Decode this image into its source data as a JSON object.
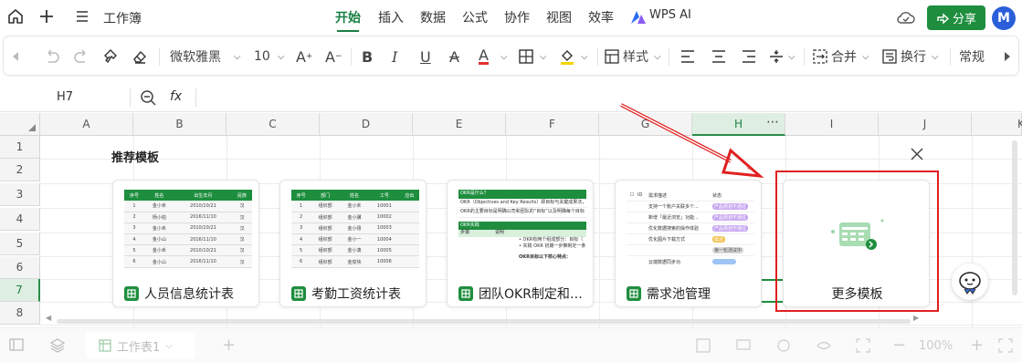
{
  "topbar": {
    "doc_title": "工作簿",
    "tabs": [
      "开始",
      "插入",
      "数据",
      "公式",
      "协作",
      "视图",
      "效率"
    ],
    "wps_ai": "WPS AI",
    "share_label": "分享",
    "avatar_letter": "M",
    "accent": "#1e8e3e"
  },
  "toolbar": {
    "font_name": "微软雅黑",
    "font_size": "10",
    "style_label": "样式",
    "merge_label": "合并",
    "wrap_label": "换行",
    "format_label": "常规"
  },
  "formula_bar": {
    "cell_ref": "H7",
    "fx": "fx"
  },
  "grid": {
    "columns": [
      "A",
      "B",
      "C",
      "D",
      "E",
      "F",
      "G",
      "H",
      "I",
      "J",
      "K"
    ],
    "rows": [
      "1",
      "2",
      "3",
      "4",
      "5",
      "6",
      "7",
      "8"
    ],
    "selected_column": "H",
    "selected_row": "7"
  },
  "templates": {
    "heading": "推荐模板",
    "cards": [
      {
        "label": "人员信息统计表"
      },
      {
        "label": "考勤工资统计表"
      },
      {
        "label": "团队OKR制定和…"
      },
      {
        "label": "需求池管理"
      }
    ],
    "more_label": "更多模板"
  },
  "thumb1": {
    "headers": [
      "序号",
      "姓名",
      "出生年月",
      "民族"
    ],
    "rows": [
      [
        "1",
        "金小禾",
        "2010/10/21",
        "汉"
      ],
      [
        "2",
        "杨小柏",
        "2016/11/10",
        "汉"
      ],
      [
        "3",
        "金小禾",
        "2010/10/21",
        "汉"
      ],
      [
        "4",
        "金小山",
        "2016/11/10",
        "汉"
      ],
      [
        "5",
        "金小禾",
        "2010/10/21",
        "汉"
      ],
      [
        "6",
        "金小山",
        "2016/11/10",
        "汉"
      ]
    ]
  },
  "thumb2": {
    "headers": [
      "序号",
      "部门",
      "姓名",
      "工号",
      "应出"
    ],
    "rows": [
      [
        "1",
        "组织部",
        "金小禾",
        "10001",
        ""
      ],
      [
        "2",
        "组织部",
        "金小骥",
        "10002",
        ""
      ],
      [
        "3",
        "组织部",
        "金小禧",
        "10003",
        ""
      ],
      [
        "4",
        "组织部",
        "金小一",
        "10004",
        ""
      ],
      [
        "5",
        "组织部",
        "金小凑",
        "10005",
        ""
      ],
      [
        "6",
        "组织部",
        "金俊快",
        "10006",
        ""
      ]
    ]
  },
  "thumb3": {
    "title": "OKR是什么？",
    "line1": "OKR（Objectives and Key Results）即目标与关键成果法，是",
    "line2": "OKR的主要目标是明确公司和团队的“目标”以及明确每个目标",
    "section": "OKR实践",
    "col1": "步骤",
    "col2": "说明",
    "items": [
      "• OKR有两个组成部分：目标（",
      "• 实践 OKR 初期一步推制定一条"
    ],
    "foot": "OKR目标以下核心特点："
  },
  "thumb4": {
    "col_a": "ID",
    "col_b": "需求描述",
    "col_c": "状态",
    "rows": [
      {
        "text": "支持一个账户关联多个...",
        "tag": "产品规划不通过",
        "color": "#c9a8f0"
      },
      {
        "text": "新增「最近浏览」功能...",
        "tag": "产品规划不通过",
        "color": "#c9a8f0"
      },
      {
        "text": "优化数据搜索的操作体验",
        "tag": "产品规划不通过",
        "color": "#c9a8f0"
      },
      {
        "text": "优化图片下载方式",
        "tag": "延迟",
        "color": "#f2c14e"
      },
      {
        "text": "",
        "tag": "第一轮测试中",
        "color": "#d9d9d9"
      },
      {
        "text": "云端数据同步功",
        "tag": "",
        "color": "#9ec3f5"
      }
    ]
  },
  "statusbar": {
    "sheet_tab": "工作表1",
    "zoom": "100%"
  }
}
